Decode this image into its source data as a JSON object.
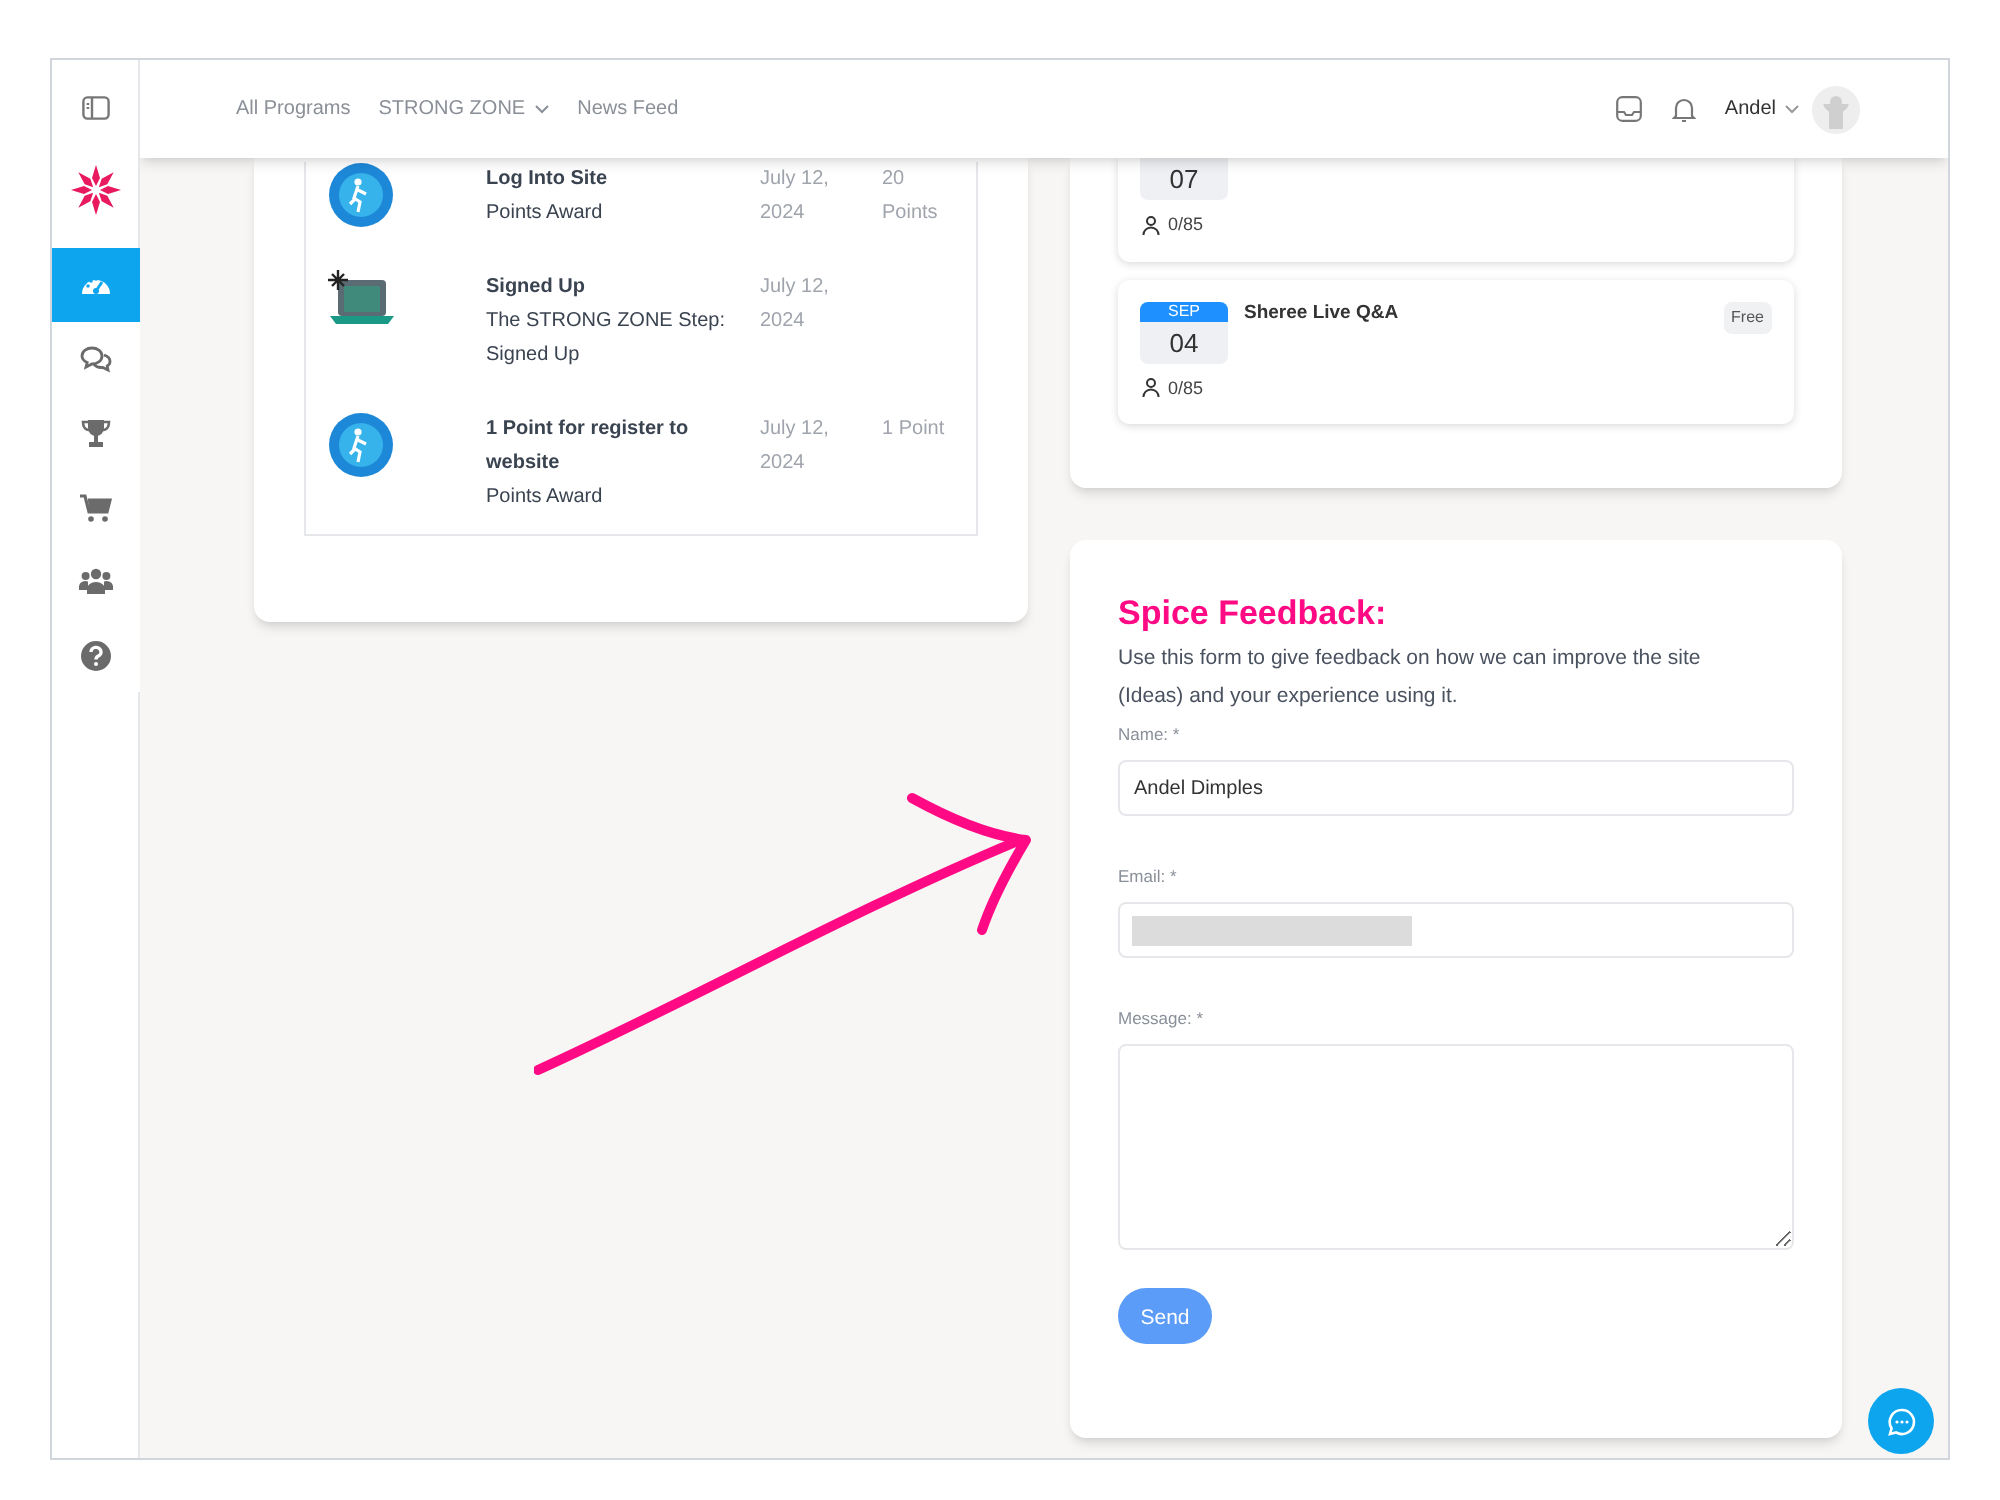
{
  "header": {
    "nav": [
      {
        "label": "All Programs",
        "dropdown": false
      },
      {
        "label": "STRONG ZONE",
        "dropdown": true
      },
      {
        "label": "News Feed",
        "dropdown": false
      }
    ],
    "user": "Andel"
  },
  "sidebar": {
    "items": [
      {
        "kind": "dashboard",
        "selected": true
      },
      {
        "kind": "chat",
        "selected": false
      },
      {
        "kind": "trophy",
        "selected": false
      },
      {
        "kind": "cart",
        "selected": false
      },
      {
        "kind": "users",
        "selected": false
      },
      {
        "kind": "help",
        "selected": false
      }
    ]
  },
  "activity": [
    {
      "kind": "runner",
      "title": "Log Into Site",
      "subtitle": "Points Award",
      "date": "July 12, 2024",
      "points": "20 Points"
    },
    {
      "kind": "laptop",
      "title": "Signed Up",
      "subtitle": "The STRONG ZONE Step: Signed Up",
      "date": "July 12, 2024"
    },
    {
      "kind": "runner",
      "title": "1 Point for register to website",
      "subtitle": "Points Award",
      "date": "July 12, 2024",
      "points": "1 Point"
    }
  ],
  "events": [
    {
      "day": "07",
      "attendees": "0/85"
    },
    {
      "month": "SEP",
      "day": "04",
      "title": "Sheree Live Q&A",
      "price": "Free",
      "attendees": "0/85"
    }
  ],
  "feedback": {
    "title": "Spice Feedback:",
    "description": "Use this form to give feedback on how we can improve the site (Ideas) and your experience using it.",
    "fields": [
      {
        "kind": "text",
        "label": "Name: *",
        "value": "Andel Dimples"
      },
      {
        "kind": "redacted",
        "label": "Email: *"
      },
      {
        "kind": "textarea",
        "label": "Message: *"
      }
    ],
    "button": "Send"
  }
}
